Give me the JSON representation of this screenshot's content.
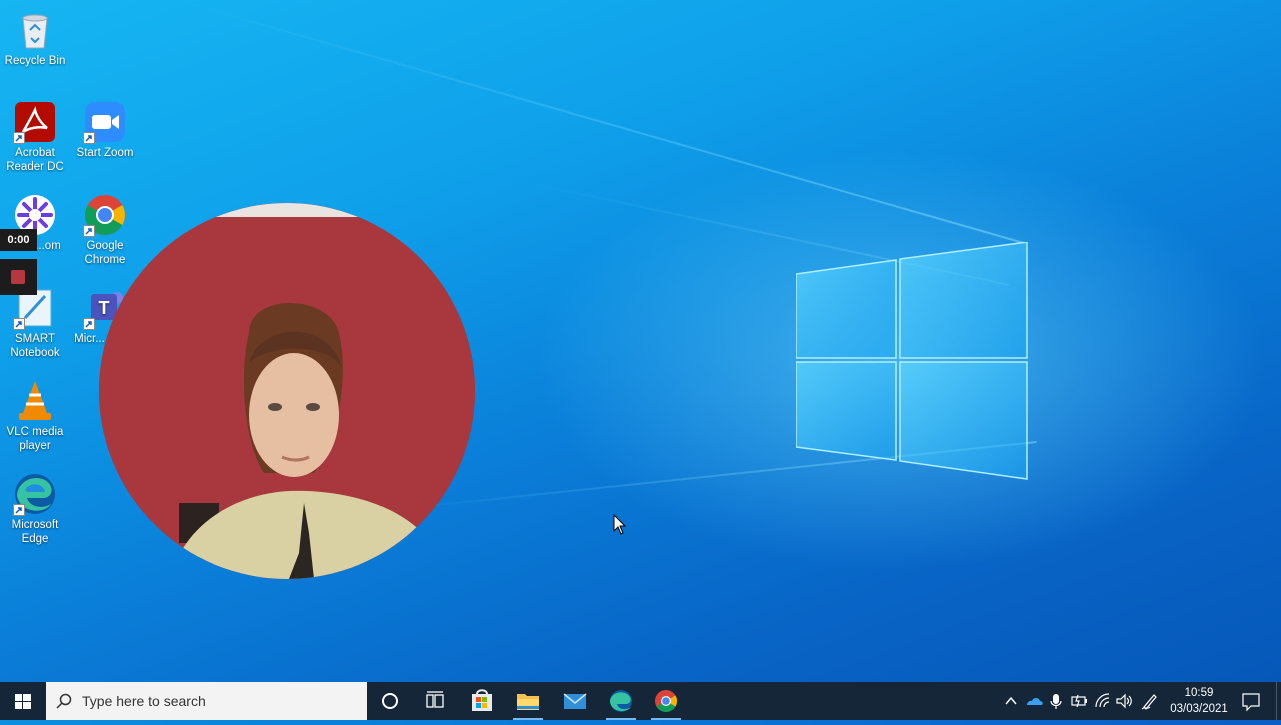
{
  "desktop": {
    "icons": [
      {
        "label": "Recycle Bin",
        "icon": "recycle-bin-icon"
      },
      {
        "label": "Acrobat Reader DC",
        "icon": "acrobat-icon"
      },
      {
        "label": "Start Zoom",
        "icon": "zoom-icon"
      },
      {
        "label": "...om",
        "icon": "screen-recorder-icon"
      },
      {
        "label": "Google Chrome",
        "icon": "chrome-icon"
      },
      {
        "label": "SMART Notebook",
        "icon": "smart-notebook-icon"
      },
      {
        "label": "Micr... Tea...",
        "icon": "teams-icon"
      },
      {
        "label": "VLC media player",
        "icon": "vlc-icon"
      },
      {
        "label": "Microsoft Edge",
        "icon": "edge-icon"
      }
    ]
  },
  "recorder": {
    "timer": "0:00",
    "stop_icon": "stop-icon"
  },
  "taskbar": {
    "search_placeholder": "Type here to search",
    "pinned": [
      "cortana-icon",
      "task-view-icon",
      "store-icon",
      "file-explorer-icon",
      "mail-icon",
      "edge-icon",
      "chrome-icon"
    ],
    "tray": [
      "chevron-up-icon",
      "onedrive-icon",
      "microphone-icon",
      "battery-icon",
      "wifi-icon",
      "volume-icon",
      "pen-icon"
    ],
    "clock": {
      "time": "10:59",
      "date": "03/03/2021"
    }
  },
  "colors": {
    "taskbar": "#142637",
    "accent": "#76b9ed",
    "desktop": "#0a7fd9"
  }
}
